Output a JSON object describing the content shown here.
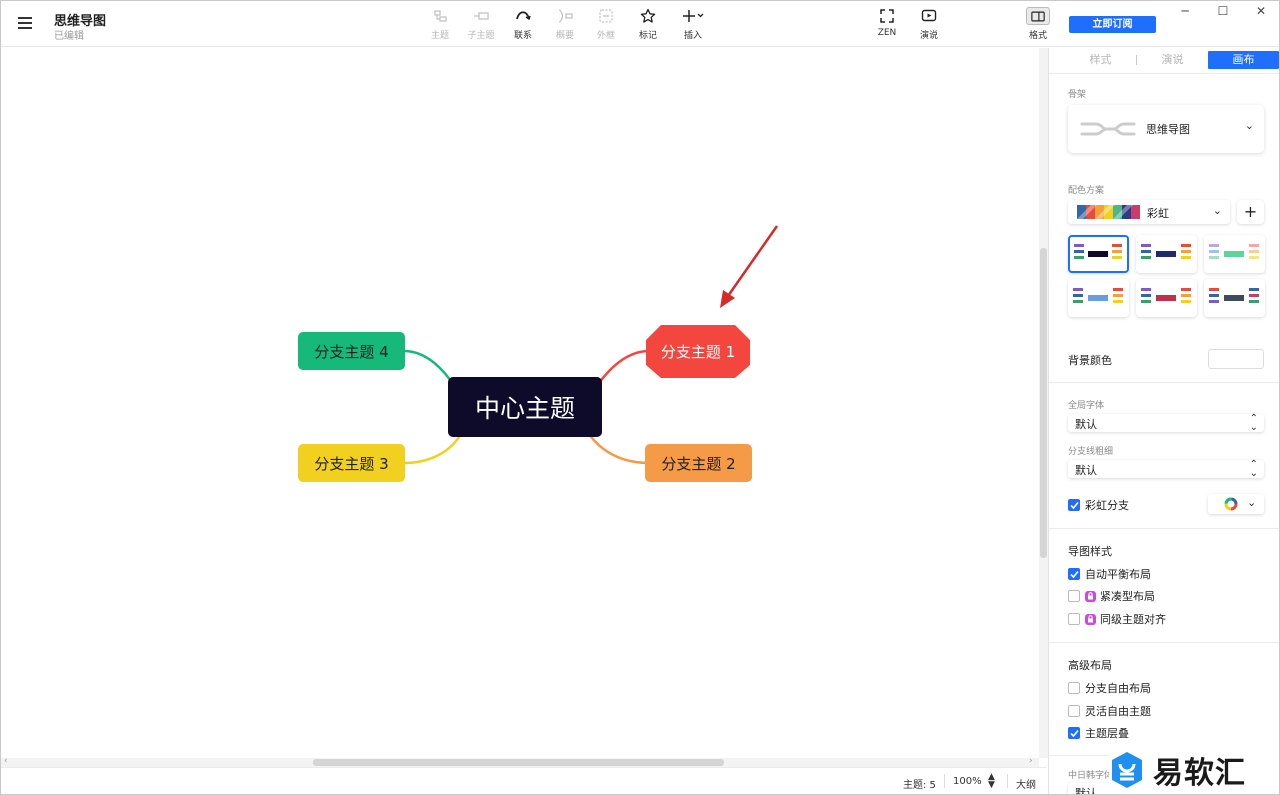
{
  "header": {
    "title": "思维导图",
    "status": "已编辑",
    "toolbar": {
      "topic": "主题",
      "subtopic": "子主题",
      "relation": "联系",
      "summary": "概要",
      "boundary": "外框",
      "marker": "标记",
      "insert": "插入",
      "zen": "ZEN",
      "present": "演说",
      "format": "格式"
    },
    "subscribe_label": "立即订阅",
    "window": {
      "minimize": "─",
      "maximize": "☐",
      "close": "✕"
    }
  },
  "mindmap": {
    "central": "中心主题",
    "branches": [
      {
        "label": "分支主题 1",
        "color": "#f2463f"
      },
      {
        "label": "分支主题 2",
        "color": "#f59a47"
      },
      {
        "label": "分支主题 3",
        "color": "#f2d01f"
      },
      {
        "label": "分支主题 4",
        "color": "#17b97a"
      }
    ],
    "central_color": "#0d0a2a"
  },
  "status_bar": {
    "topics": "主题: 5",
    "zoom": "100%",
    "outline": "大纲"
  },
  "panel": {
    "tabs": [
      "样式",
      "演说",
      "画布"
    ],
    "active_tab": "画布",
    "skeleton_label": "骨架",
    "skeleton_value": "思维导图",
    "color_scheme_label": "配色方案",
    "color_scheme_value": "彩虹",
    "bg_color_label": "背景颜色",
    "global_font_label": "全局字体",
    "global_font_value": "默认",
    "branch_width_label": "分支线粗细",
    "branch_width_value": "默认",
    "rainbow_branch_label": "彩虹分支",
    "rainbow_branch_checked": true,
    "map_style_head": "导图样式",
    "map_style": [
      {
        "label": "自动平衡布局",
        "checked": true,
        "locked": false
      },
      {
        "label": "紧凑型布局",
        "checked": false,
        "locked": true
      },
      {
        "label": "同级主题对齐",
        "checked": false,
        "locked": true
      }
    ],
    "advanced_head": "高级布局",
    "advanced": [
      {
        "label": "分支自由布局",
        "checked": false
      },
      {
        "label": "灵活自由主题",
        "checked": false
      },
      {
        "label": "主题层叠",
        "checked": true
      }
    ],
    "cjk_font_label": "中日韩字体",
    "cjk_font_value": "默认"
  },
  "watermark": "易软汇",
  "accent": "#1f6fff"
}
